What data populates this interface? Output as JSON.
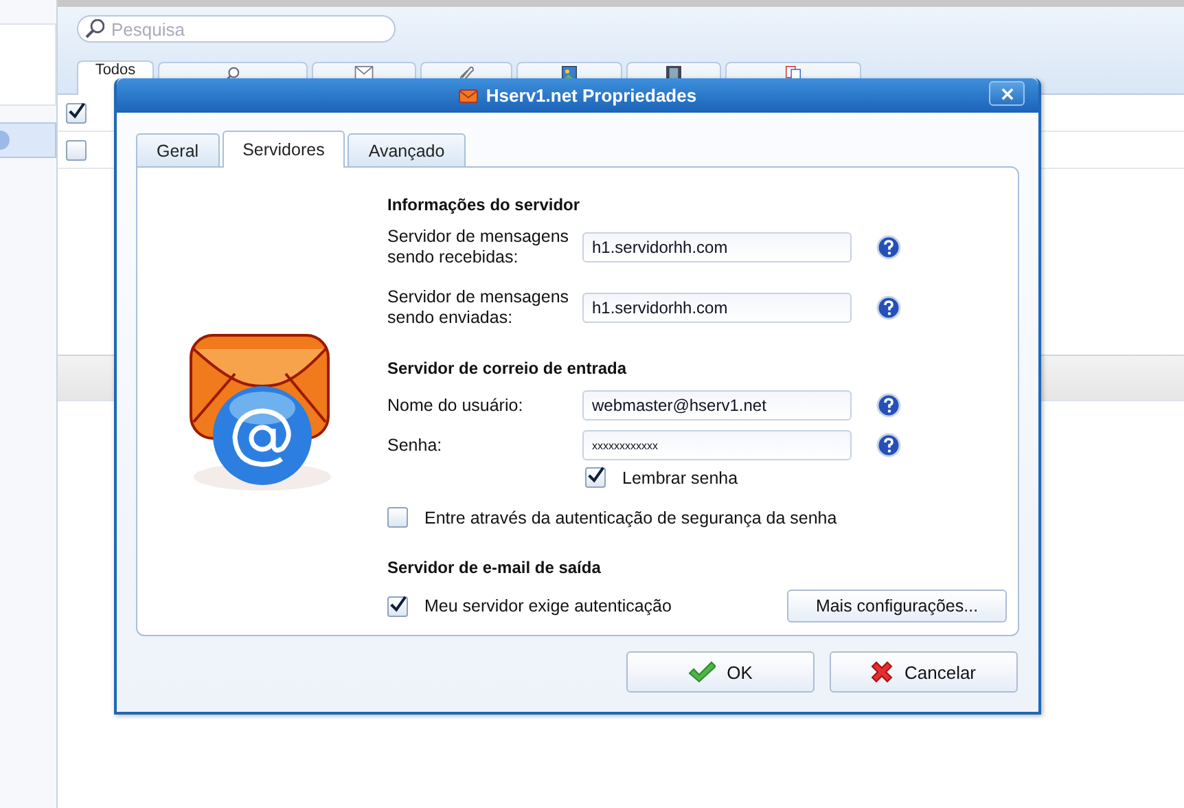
{
  "app": {
    "search": {
      "placeholder": "Pesquisa"
    },
    "tabs": [
      {
        "label": "Todos",
        "kind": "plain",
        "selected": true
      },
      {
        "kind": "search",
        "selected": false
      },
      {
        "kind": "mail",
        "selected": false
      },
      {
        "kind": "clip",
        "selected": false
      },
      {
        "kind": "image",
        "selected": false
      },
      {
        "kind": "video",
        "selected": false
      },
      {
        "kind": "doc",
        "selected": false
      }
    ],
    "rows": [
      {
        "checked": true
      },
      {
        "checked": false
      }
    ]
  },
  "dialog": {
    "title": "Hserv1.net Propriedades",
    "tabs": [
      {
        "label": "Geral",
        "selected": false
      },
      {
        "label": "Servidores",
        "selected": true
      },
      {
        "label": "Avançado",
        "selected": false
      }
    ],
    "sections": [
      {
        "heading": "Informações do servidor",
        "items": [
          {
            "kind": "field",
            "label": "Servidor de mensagens sendo recebidas:",
            "value": "h1.servidorhh.com"
          },
          {
            "kind": "field",
            "label": "Servidor de mensagens sendo enviadas:",
            "value": "h1.servidorhh.com"
          }
        ]
      },
      {
        "heading": "Servidor de correio de entrada",
        "items": [
          {
            "kind": "field",
            "label": "Nome do usuário:",
            "value": "webmaster@hserv1.net"
          },
          {
            "kind": "field",
            "label": "Senha:",
            "value": "xxxxxxxxxxxx"
          },
          {
            "kind": "indented_check",
            "label": "Lembrar senha",
            "checked": true
          },
          {
            "kind": "check",
            "label": "Entre através da autenticação de segurança da senha",
            "checked": false
          }
        ]
      },
      {
        "heading": "Servidor de e-mail de saída",
        "items": [
          {
            "kind": "check_button",
            "label": "Meu servidor exige autenticação",
            "checked": true,
            "button": "Mais configurações..."
          }
        ]
      }
    ],
    "buttons": [
      {
        "label": "OK",
        "kind": "ok"
      },
      {
        "label": "Cancelar",
        "kind": "cancel"
      }
    ]
  }
}
